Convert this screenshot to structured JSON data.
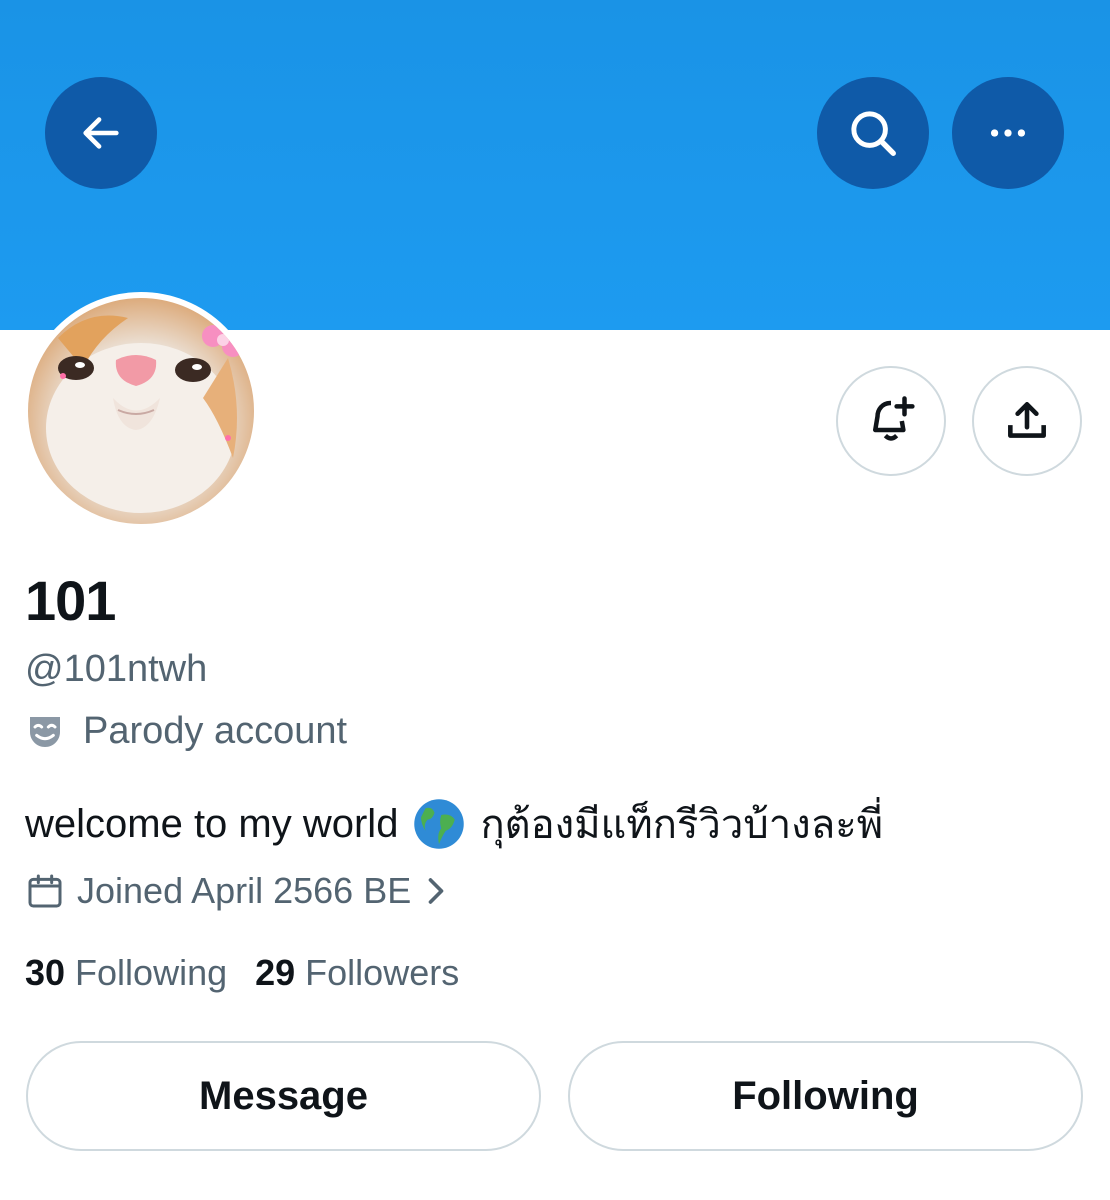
{
  "header": {
    "back_icon": "arrow-left-icon",
    "search_icon": "search-icon",
    "more_icon": "more-horizontal-icon",
    "banner_color": "#1d9bf0",
    "button_color": "#0f5aa8"
  },
  "profile": {
    "avatar_icon": "cat-avatar",
    "display_name": "101",
    "handle": "@101ntwh",
    "parody_label": "Parody account",
    "bio_text": "welcome to my world",
    "bio_emoji": "globe-icon",
    "bio_thai": "กุต้องมีแท็กรีวิวบ้างละพี่",
    "joined_text": "Joined April 2566 BE",
    "following_count": "30",
    "following_label": "Following",
    "followers_count": "29",
    "followers_label": "Followers"
  },
  "actions": {
    "notify_icon": "bell-plus-icon",
    "share_icon": "share-icon",
    "message_label": "Message",
    "following_button_label": "Following"
  }
}
